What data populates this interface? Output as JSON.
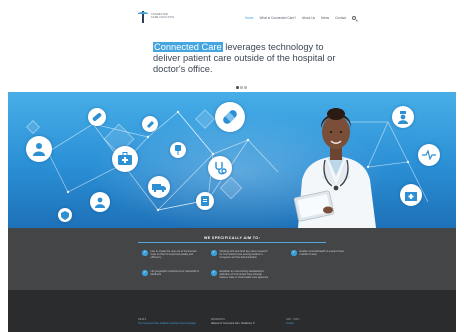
{
  "header": {
    "logo_line1": "CONNECTED",
    "logo_line2": "CARE COALITION",
    "nav": [
      {
        "label": "Home",
        "active": true
      },
      {
        "label": "What is Connected Care?",
        "active": false
      },
      {
        "label": "About Us",
        "active": false
      },
      {
        "label": "News",
        "active": false
      },
      {
        "label": "Contact",
        "active": false
      }
    ]
  },
  "hero": {
    "highlight": "Connected Care",
    "rest": " leverages technology to deliver patient care outside of the hospital or doctor's office.",
    "dots": 3,
    "active_dot": 0
  },
  "banner": {
    "colors": {
      "top": "#47aee8",
      "bottom": "#1e71b8"
    },
    "icons": [
      "patient-icon",
      "pill-icon",
      "syringe-icon",
      "medical-kit-icon",
      "iv-drip-icon",
      "bandage-icon",
      "ambulance-icon",
      "clipboard-icon",
      "stethoscope-icon",
      "heart-rate-icon",
      "nurse-icon",
      "hospital-icon",
      "doctor-avatar-icon",
      "shield-icon"
    ]
  },
  "aims": {
    "title": "WE SPECIFICALLY AIM TO:",
    "items": [
      "Use to create the new era of Connected Care so that it's improved quality and efficiency",
      "Working with and brief key Hans research for Connected Care among leaders in Congress and the Administration",
      "Enable rural telehealth to expand Care outside of area",
      "Lift geographic restrictions for telehealth in Medicare",
      "Establish an overarching standardized definition of Connected Care through federal, state or local health care agencies"
    ]
  },
  "footer": {
    "col1_head": "NEWS",
    "col1_text": "The Connected Care Coalition Launches New Campaign",
    "col2_head": "MEMBERS",
    "col2_text": "Alliance for Connected Care, Healthcare IT",
    "col3_head": "GET INFO",
    "col3_text": "Contact"
  }
}
